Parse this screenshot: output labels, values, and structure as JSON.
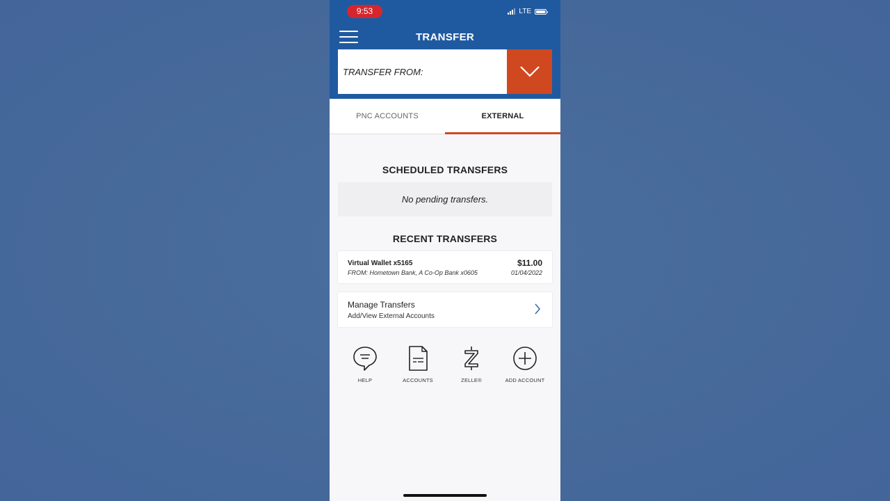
{
  "status_bar": {
    "time": "9:53",
    "network": "LTE"
  },
  "header": {
    "title": "TRANSFER",
    "transfer_from_label": "TRANSFER FROM:"
  },
  "tabs": [
    {
      "label": "PNC ACCOUNTS",
      "active": false
    },
    {
      "label": "EXTERNAL",
      "active": true
    }
  ],
  "scheduled": {
    "title": "SCHEDULED TRANSFERS",
    "empty_text": "No pending transfers."
  },
  "recent": {
    "title": "RECENT TRANSFERS",
    "items": [
      {
        "account": "Virtual Wallet x5165",
        "from": "FROM: Hometown Bank, A Co-Op Bank x0605",
        "amount": "$11.00",
        "date": "01/04/2022"
      }
    ]
  },
  "manage": {
    "title": "Manage Transfers",
    "subtitle": "Add/View External Accounts"
  },
  "shortcuts": [
    {
      "label": "HELP",
      "icon": "help-chat-icon"
    },
    {
      "label": "ACCOUNTS",
      "icon": "document-icon"
    },
    {
      "label": "ZELLE®",
      "icon": "zelle-icon"
    },
    {
      "label": "ADD ACCOUNT",
      "icon": "add-circle-icon"
    }
  ],
  "colors": {
    "primary_blue": "#1f5aa0",
    "accent_orange": "#d0481f",
    "status_red": "#d6262d"
  }
}
